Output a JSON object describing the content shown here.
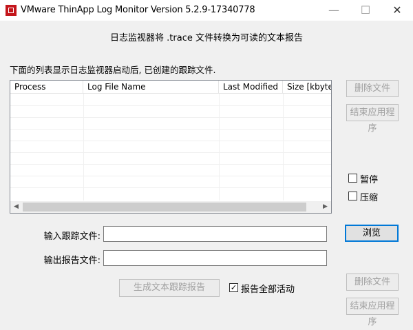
{
  "window": {
    "title": "VMware ThinApp Log Monitor Version 5.2.9-17340778",
    "minimize": "—",
    "maximize": "☐",
    "close": "✕"
  },
  "subtitle": "日志监视器将 .trace 文件转换为可读的文本报告",
  "description": "下面的列表显示日志监视器启动后, 已创建的跟踪文件.",
  "list": {
    "columns": [
      "Process",
      "Log File Name",
      "Last Modified",
      "Size [kbytes]"
    ],
    "rows": []
  },
  "buttons": {
    "delete_file": "删除文件",
    "end_app": "结束应用程序",
    "browse": "浏览",
    "generate": "生成文本跟踪报告",
    "delete_file_2": "删除文件",
    "end_app_2": "结束应用程序"
  },
  "options": {
    "pause": "暂停",
    "pause_checked": false,
    "compress": "压缩",
    "compress_checked": false,
    "report_all": "报告全部活动",
    "report_all_checked": true
  },
  "fields": {
    "input_trace_label": "输入跟踪文件:",
    "input_trace_value": "",
    "output_report_label": "输出报告文件:",
    "output_report_value": ""
  }
}
